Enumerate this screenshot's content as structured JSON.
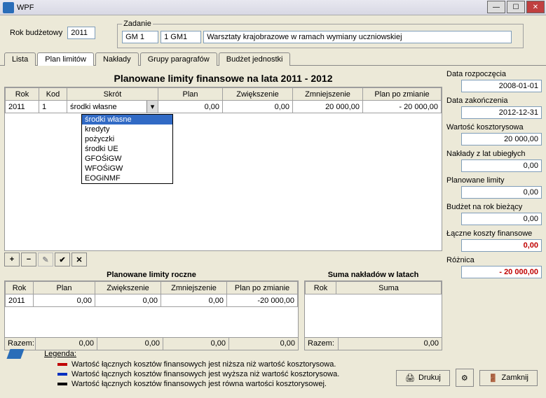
{
  "window": {
    "title": "WPF"
  },
  "form": {
    "rok_label": "Rok budżetowy",
    "rok_value": "2011",
    "zadanie_legend": "Zadanie",
    "zad_code1": "GM 1",
    "zad_code2": "1 GM1",
    "zad_desc": "Warsztaty krajobrazowe w ramach wymiany uczniowskiej"
  },
  "tabs": [
    "Lista",
    "Plan limitów",
    "Nakłady",
    "Grupy paragrafów",
    "Budżet jednostki"
  ],
  "active_tab": "Plan limitów",
  "main_heading": "Planowane limity finansowe na lata 2011 - 2012",
  "cols": [
    "Rok",
    "Kod",
    "Skrót",
    "Plan",
    "Zwiększenie",
    "Zmniejszenie",
    "Plan po zmianie"
  ],
  "row": {
    "rok": "2011",
    "kod": "1",
    "skrot": "środki własne",
    "plan": "0,00",
    "zwiekszenie": "0,00",
    "zmniejszenie": "20 000,00",
    "po_zmianie": "-   20 000,00"
  },
  "options": [
    "środki własne",
    "kredyty",
    "pożyczki",
    "środki UE",
    "GFOŚiGW",
    "WFOŚiGW",
    "EOGiNMF"
  ],
  "toolbar": {
    "add": "+",
    "del": "−",
    "edit": "✎",
    "ok": "✔",
    "cancel": "✕"
  },
  "lower_left": {
    "title": "Planowane limity roczne",
    "cols": [
      "Rok",
      "Plan",
      "Zwiększenie",
      "Zmniejszenie",
      "Plan po zmianie"
    ],
    "row": {
      "rok": "2011",
      "plan": "0,00",
      "zw": "0,00",
      "zm": "0,00",
      "pz": "-20 000,00"
    },
    "razem_label": "Razem:",
    "razem": {
      "plan": "0,00",
      "zw": "0,00",
      "zm": "0,00",
      "pz": "0,00"
    }
  },
  "lower_right": {
    "title": "Suma nakładów w latach",
    "cols": [
      "Rok",
      "Suma"
    ],
    "razem_label": "Razem:",
    "razem_val": "0,00"
  },
  "side": {
    "data_rozp_l": "Data rozpoczęcia",
    "data_rozp": "2008-01-01",
    "data_zak_l": "Data zakończenia",
    "data_zak": "2012-12-31",
    "wart_l": "Wartość kosztorysowa",
    "wart": "20 000,00",
    "nakl_l": "Nakłady z lat ubiegłych",
    "nakl": "0,00",
    "plan_l": "Planowane limity",
    "plan": "0,00",
    "bud_l": "Budżet na rok bieżący",
    "bud": "0,00",
    "lac_l": "Łączne koszty finansowe",
    "lac": "0,00",
    "roz_l": "Różnica",
    "roz": "-   20 000,00"
  },
  "legend": {
    "title": "Legenda:",
    "l1": "Wartość łącznych kosztów finansowych jest niższa niż wartość kosztorysowa.",
    "l2": "Wartość łącznych kosztów finansowych jest wyższa niż wartość kosztorysowa.",
    "l3": "Wartość łącznych kosztów finansowych jest równa wartości kosztorysowej."
  },
  "buttons": {
    "drukuj": "Drukuj",
    "zamknij": "Zamknij"
  }
}
